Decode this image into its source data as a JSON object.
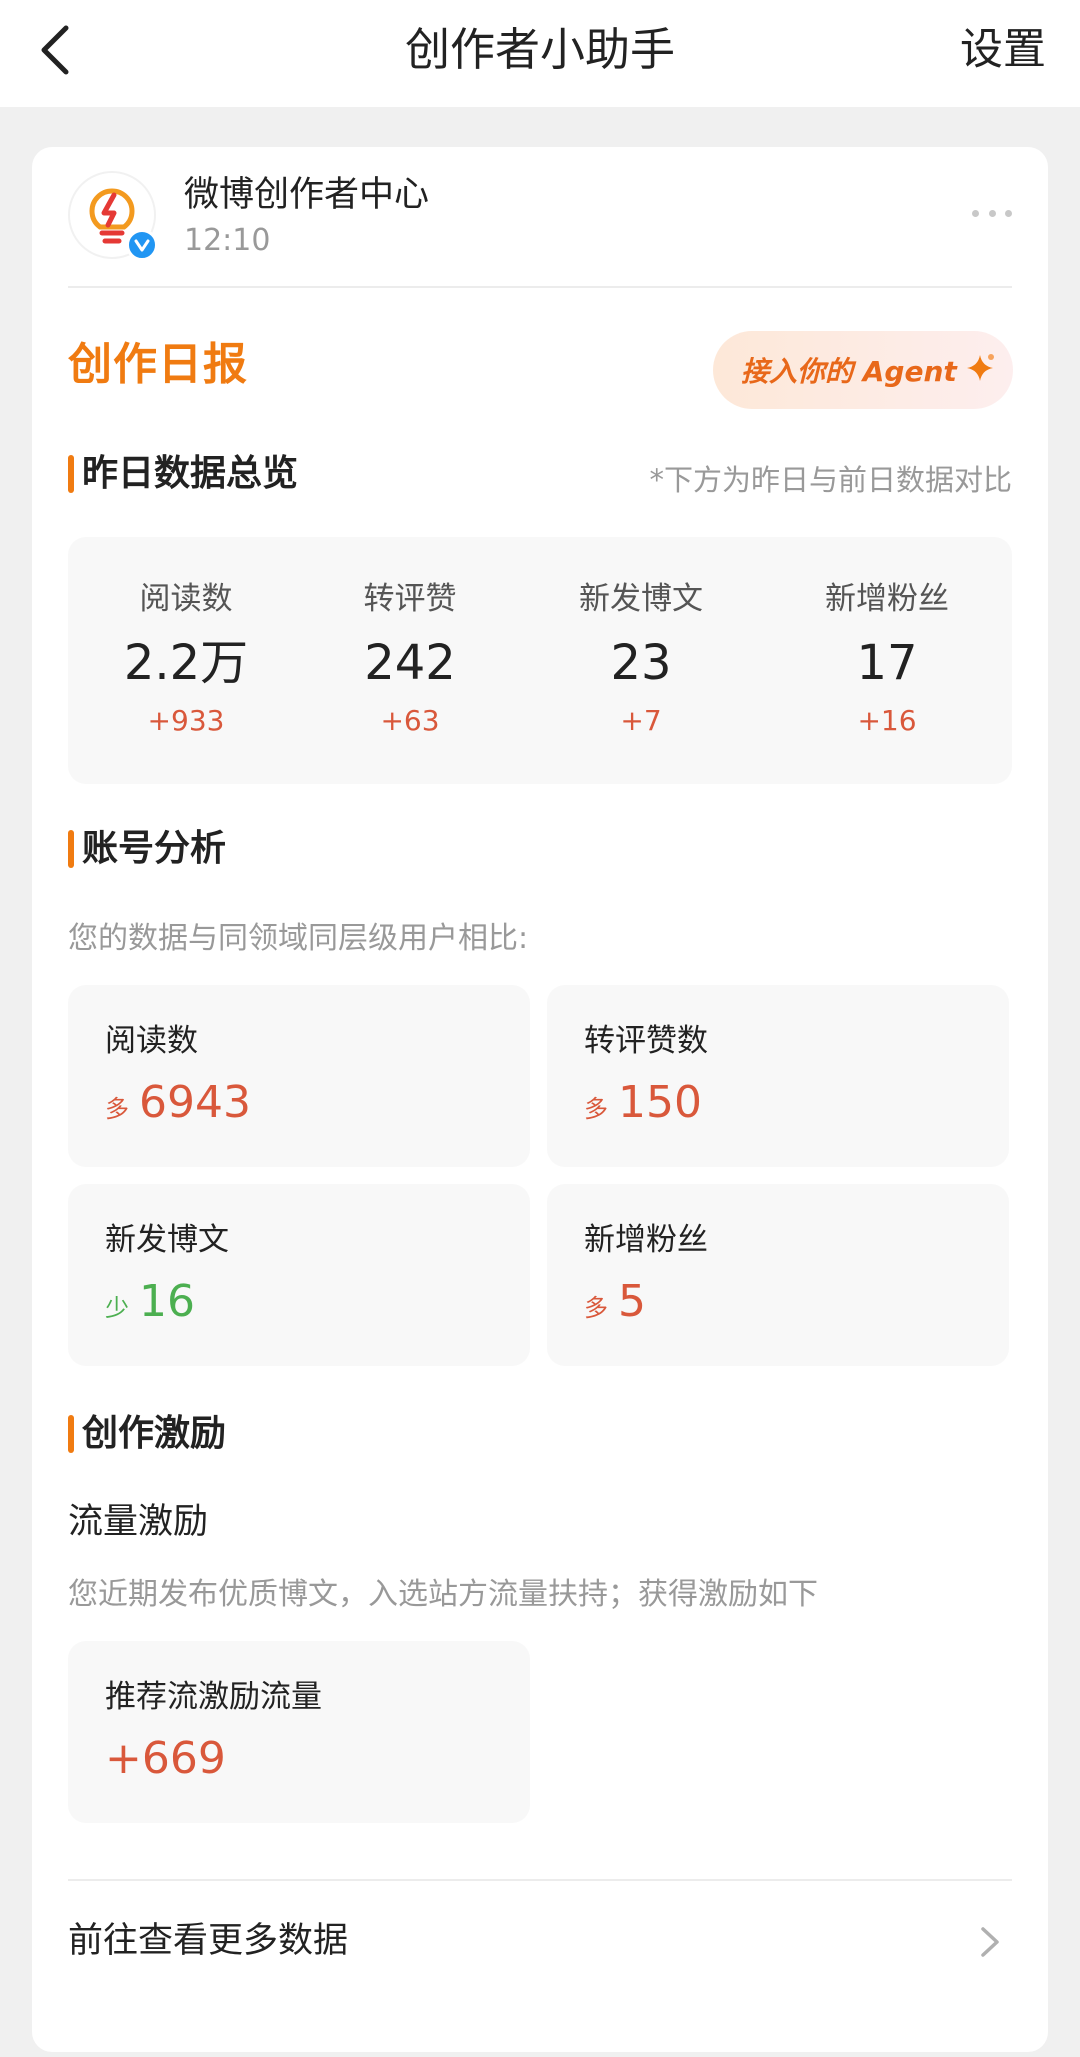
{
  "nav": {
    "title": "创作者小助手",
    "settings_label": "设置",
    "back_icon": "chevron-left-icon"
  },
  "post": {
    "account_name": "微博创作者中心",
    "time": "12:10",
    "avatar_icon": "lightbulb-lightning-icon",
    "verified_icon": "verified-v-icon"
  },
  "report": {
    "title": "创作日报",
    "agent_button_label": "接入你的 Agent",
    "agent_icon": "sparkle-icon"
  },
  "overview": {
    "title": "昨日数据总览",
    "note": "*下方为昨日与前日数据对比",
    "stats": [
      {
        "label": "阅读数",
        "value": "2.2万",
        "delta": "+933"
      },
      {
        "label": "转评赞",
        "value": "242",
        "delta": "+63"
      },
      {
        "label": "新发博文",
        "value": "23",
        "delta": "+7"
      },
      {
        "label": "新增粉丝",
        "value": "17",
        "delta": "+16"
      }
    ]
  },
  "analysis": {
    "title": "账号分析",
    "intro": "您的数据与同领域同层级用户相比:",
    "metrics": [
      {
        "label": "阅读数",
        "direction": "多",
        "value": "6943"
      },
      {
        "label": "转评赞数",
        "direction": "多",
        "value": "150"
      },
      {
        "label": "新发博文",
        "direction": "少",
        "value": "16"
      },
      {
        "label": "新增粉丝",
        "direction": "多",
        "value": "5"
      }
    ]
  },
  "incentive": {
    "title": "创作激励",
    "subtitle": "流量激励",
    "description": "您近期发布优质博文，入选站方流量扶持；获得激励如下",
    "card_label": "推荐流激励流量",
    "card_value": "+669"
  },
  "footer": {
    "more_data_label": "前往查看更多数据"
  },
  "colors": {
    "accent_orange": "#f07b11",
    "increase_red": "#d9583b",
    "decrease_green": "#4caf50",
    "verified_blue": "#2196f3"
  }
}
